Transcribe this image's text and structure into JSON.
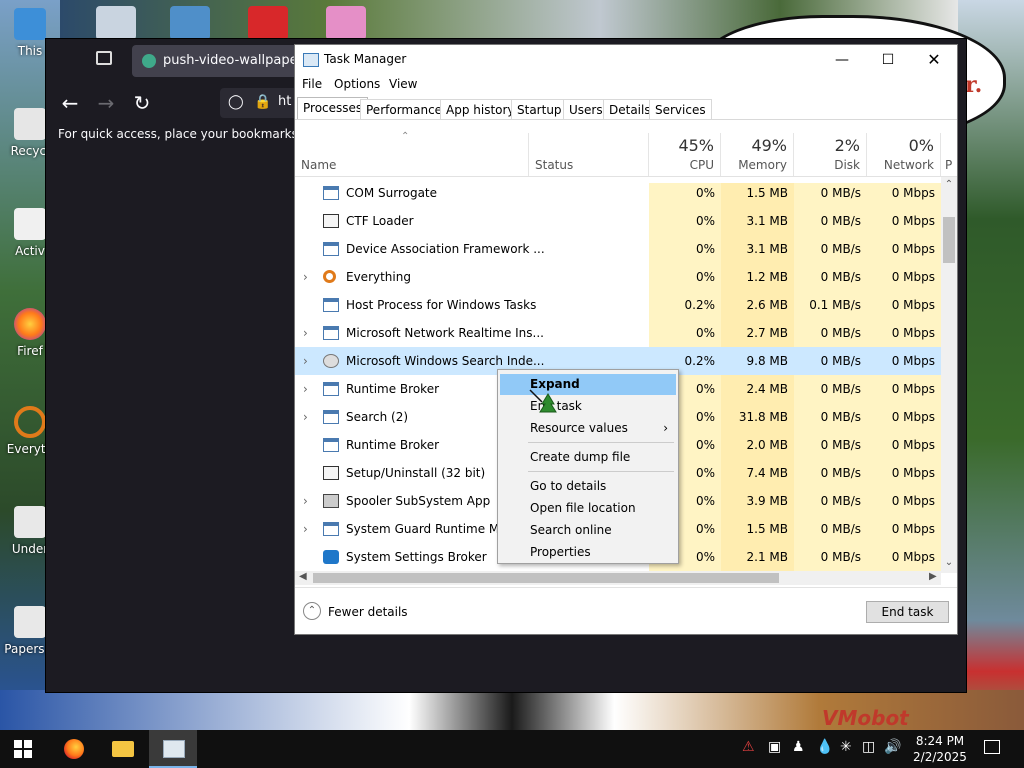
{
  "desktop": {
    "icons": [
      {
        "label": "This"
      },
      {
        "label": "Recycl"
      },
      {
        "label": "Activ"
      },
      {
        "label": "Firef"
      },
      {
        "label": "Everyth"
      },
      {
        "label": "Under"
      },
      {
        "label": "Papers, I"
      }
    ],
    "speech_text": "r.",
    "watermark": "VMobot"
  },
  "browser": {
    "tab_title": "push-video-wallpaper.en",
    "url_text": "ht",
    "bookmarks_hint": "For quick access, place your bookmarks here",
    "back_icon": "arrow-left-icon",
    "forward_icon": "arrow-right-icon",
    "reload_icon": "reload-icon"
  },
  "taskmanager": {
    "title": "Task Manager",
    "menu": [
      "File",
      "Options",
      "View"
    ],
    "tabs": [
      "Processes",
      "Performance",
      "App history",
      "Startup",
      "Users",
      "Details",
      "Services"
    ],
    "active_tab": "Processes",
    "columns": {
      "name": "Name",
      "status": "Status",
      "cpu": {
        "pct": "45%",
        "label": "CPU"
      },
      "memory": {
        "pct": "49%",
        "label": "Memory"
      },
      "disk": {
        "pct": "2%",
        "label": "Disk"
      },
      "network": {
        "pct": "0%",
        "label": "Network"
      },
      "partial": "P"
    },
    "rows": [
      {
        "name": "COM Surrogate",
        "expandable": false,
        "icon": "window-icon",
        "cpu": "0%",
        "memory": "1.5 MB",
        "disk": "0 MB/s",
        "network": "0 Mbps"
      },
      {
        "name": "CTF Loader",
        "expandable": false,
        "icon": "ctf-icon",
        "cpu": "0%",
        "memory": "3.1 MB",
        "disk": "0 MB/s",
        "network": "0 Mbps"
      },
      {
        "name": "Device Association Framework ...",
        "expandable": false,
        "icon": "window-icon",
        "cpu": "0%",
        "memory": "3.1 MB",
        "disk": "0 MB/s",
        "network": "0 Mbps"
      },
      {
        "name": "Everything",
        "expandable": true,
        "icon": "search-icon",
        "cpu": "0%",
        "memory": "1.2 MB",
        "disk": "0 MB/s",
        "network": "0 Mbps"
      },
      {
        "name": "Host Process for Windows Tasks",
        "expandable": false,
        "icon": "window-icon",
        "cpu": "0.2%",
        "memory": "2.6 MB",
        "disk": "0.1 MB/s",
        "network": "0 Mbps"
      },
      {
        "name": "Microsoft Network Realtime Ins...",
        "expandable": true,
        "icon": "window-icon",
        "cpu": "0%",
        "memory": "2.7 MB",
        "disk": "0 MB/s",
        "network": "0 Mbps"
      },
      {
        "name": "Microsoft Windows Search Inde...",
        "expandable": true,
        "icon": "user-icon",
        "cpu": "0.2%",
        "memory": "9.8 MB",
        "disk": "0 MB/s",
        "network": "0 Mbps",
        "selected": true
      },
      {
        "name": "Runtime Broker",
        "expandable": true,
        "icon": "window-icon",
        "cpu": "0%",
        "memory": "2.4 MB",
        "disk": "0 MB/s",
        "network": "0 Mbps"
      },
      {
        "name": "Search (2)",
        "expandable": true,
        "icon": "window-icon",
        "cpu": "0%",
        "memory": "31.8 MB",
        "disk": "0 MB/s",
        "network": "0 Mbps"
      },
      {
        "name": "Runtime Broker",
        "expandable": false,
        "icon": "window-icon",
        "cpu": "0%",
        "memory": "2.0 MB",
        "disk": "0 MB/s",
        "network": "0 Mbps"
      },
      {
        "name": "Setup/Uninstall (32 bit)",
        "expandable": false,
        "icon": "setup-icon",
        "cpu": "0%",
        "memory": "7.4 MB",
        "disk": "0 MB/s",
        "network": "0 Mbps"
      },
      {
        "name": "Spooler SubSystem App",
        "expandable": true,
        "icon": "printer-icon",
        "cpu": "0%",
        "memory": "3.9 MB",
        "disk": "0 MB/s",
        "network": "0 Mbps"
      },
      {
        "name": "System Guard Runtime Mon",
        "expandable": true,
        "icon": "window-icon",
        "cpu": "0%",
        "memory": "1.5 MB",
        "disk": "0 MB/s",
        "network": "0 Mbps"
      },
      {
        "name": "System Settings Broker",
        "expandable": false,
        "icon": "gear-icon",
        "cpu": "0%",
        "memory": "2.1 MB",
        "disk": "0 MB/s",
        "network": "0 Mbps"
      }
    ],
    "footer": {
      "fewer_details": "Fewer details",
      "end_task": "End task"
    }
  },
  "context_menu": {
    "items": [
      {
        "label": "Expand",
        "highlighted": true
      },
      {
        "label": "End task"
      },
      {
        "label": "Resource values",
        "submenu": true
      },
      {
        "label": "Create dump file"
      },
      {
        "label": "Go to details"
      },
      {
        "label": "Open file location"
      },
      {
        "label": "Search online"
      },
      {
        "label": "Properties"
      }
    ]
  },
  "taskbar": {
    "time": "8:24 PM",
    "date": "2/2/2025"
  }
}
